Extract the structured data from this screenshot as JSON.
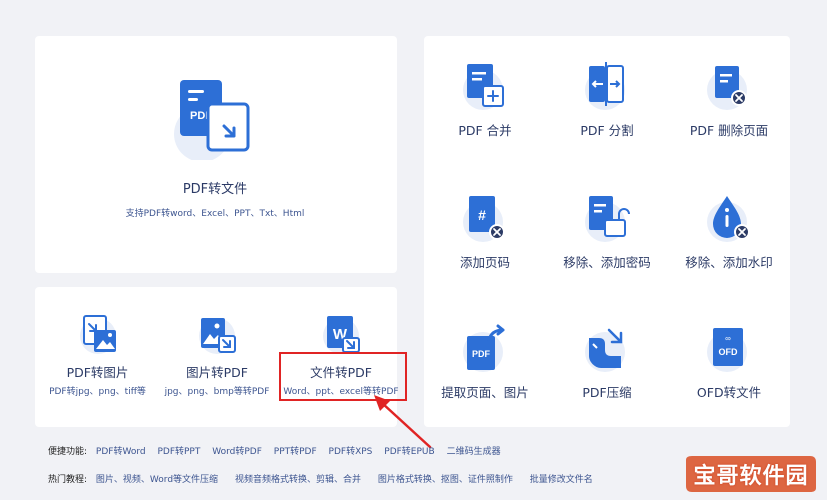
{
  "main_card": {
    "title": "PDF转文件",
    "subtitle": "支持PDF转word、Excel、PPT、Txt、Html",
    "icon": "pdf-convert-icon",
    "icon_badge": "PDF"
  },
  "bottom_tools": [
    {
      "label": "PDF转图片",
      "sub": "PDF转jpg、png、tiff等",
      "icon": "pdf-to-image-icon"
    },
    {
      "label": "图片转PDF",
      "sub": "jpg、png、bmp等转PDF",
      "icon": "image-to-pdf-icon"
    },
    {
      "label": "文件转PDF",
      "sub": "Word、ppt、excel等转PDF",
      "icon": "word-to-pdf-icon",
      "badge": "W"
    }
  ],
  "grid_tools": [
    {
      "label": "PDF 合并",
      "icon": "pdf-merge-icon"
    },
    {
      "label": "PDF 分割",
      "icon": "pdf-split-icon"
    },
    {
      "label": "PDF 删除页面",
      "icon": "pdf-delete-page-icon"
    },
    {
      "label": "添加页码",
      "icon": "add-page-number-icon"
    },
    {
      "label": "移除、添加密码",
      "icon": "password-icon"
    },
    {
      "label": "移除、添加水印",
      "icon": "watermark-icon"
    },
    {
      "label": "提取页面、图片",
      "icon": "extract-page-icon",
      "badge": "PDF"
    },
    {
      "label": "PDF压缩",
      "icon": "pdf-compress-icon"
    },
    {
      "label": "OFD转文件",
      "icon": "ofd-convert-icon",
      "badge": "OFD"
    }
  ],
  "quick_links": {
    "heading": "便捷功能:",
    "items": [
      "PDF转Word",
      "PDF转PPT",
      "Word转PDF",
      "PPT转PDF",
      "PDF转XPS",
      "PDF转EPUB",
      "二维码生成器"
    ]
  },
  "hot_tutorials": {
    "heading": "热门教程:",
    "items": [
      "图片、视频、Word等文件压缩",
      "视频音频格式转换、剪辑、合并",
      "图片格式转换、抠图、证件照制作",
      "批量修改文件名"
    ]
  },
  "watermark": {
    "text": "宝哥软件园"
  },
  "colors": {
    "accent": "#2d6fd6",
    "accent_light": "#dbe8fa",
    "highlight": "#e02424"
  }
}
